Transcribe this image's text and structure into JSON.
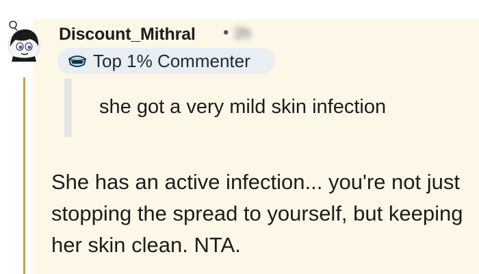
{
  "comment": {
    "username": "Discount_Mithral",
    "separator": "•",
    "timestamp": "2h",
    "flair": {
      "label": "Top 1% Commenter",
      "icon": "top-commenter-badge-icon"
    },
    "quote": "she got a very mild skin infection",
    "body": "She has an active infection... you're not just stopping the spread to yourself, but keeping her skin clean. NTA."
  },
  "colors": {
    "comment_background": "#fdf7e8",
    "thread_line": "#c9a343",
    "flair_background": "#e8eef2",
    "quote_bar": "#e4e4e4"
  }
}
